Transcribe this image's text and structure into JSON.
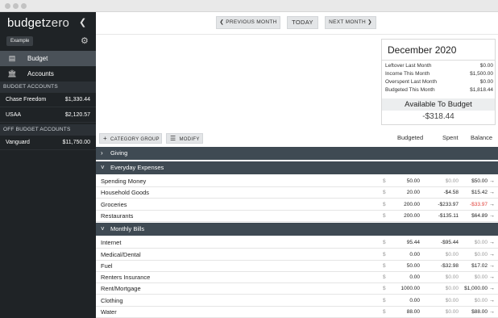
{
  "app": {
    "logo_main": "budget",
    "logo_accent": "zero",
    "collapse_icon": "chevron-left-icon"
  },
  "sidebar": {
    "budget_name": "Example",
    "nav": [
      {
        "label": "Budget",
        "icon": "wallet-icon",
        "active": true
      },
      {
        "label": "Accounts",
        "icon": "bank-icon",
        "active": false
      }
    ],
    "budget_accounts_label": "BUDGET ACCOUNTS",
    "budget_accounts": [
      {
        "name": "Chase Freedom",
        "balance": "$1,330.44"
      },
      {
        "name": "USAA",
        "balance": "$2,120.57"
      }
    ],
    "off_budget_label": "OFF BUDGET ACCOUNTS",
    "off_budget_accounts": [
      {
        "name": "Vanguard",
        "balance": "$11,750.00"
      }
    ]
  },
  "topnav": {
    "prev": "PREVIOUS MONTH",
    "today": "TODAY",
    "next": "NEXT MONTH"
  },
  "summary": {
    "month": "December 2020",
    "rows": [
      {
        "label": "Leftover Last Month",
        "value": "$0.00"
      },
      {
        "label": "Income This Month",
        "value": "$1,500.00"
      },
      {
        "label": "Overspent Last Month",
        "value": "$0.00"
      },
      {
        "label": "Budgeted This Month",
        "value": "$1,818.44"
      }
    ],
    "available_label": "Available To Budget",
    "available_value": "-$318.44"
  },
  "toolbar": {
    "category_group": "CATEGORY GROUP",
    "modify": "MODIFY"
  },
  "columns": {
    "budgeted": "Budgeted",
    "spent": "Spent",
    "balance": "Balance"
  },
  "currency_symbol": "$",
  "groups": [
    {
      "name": "Giving",
      "expanded": false,
      "categories": []
    },
    {
      "name": "Everyday Expenses",
      "expanded": true,
      "categories": [
        {
          "name": "Spending Money",
          "budgeted": "",
          "spent": "$0.00",
          "balance": "$50.00",
          "spent_tone": "grey",
          "balance_tone": "dark",
          "bud_display": "50.00"
        },
        {
          "name": "Household Goods",
          "budgeted": "20.00",
          "spent": "-$4.58",
          "balance": "$15.42",
          "spent_tone": "dark",
          "balance_tone": "dark"
        },
        {
          "name": "Groceries",
          "budgeted": "200.00",
          "spent": "-$233.97",
          "balance": "-$33.97",
          "spent_tone": "dark",
          "balance_tone": "red"
        },
        {
          "name": "Restaurants",
          "budgeted": "200.00",
          "spent": "-$135.11",
          "balance": "$64.89",
          "spent_tone": "dark",
          "balance_tone": "dark"
        }
      ]
    },
    {
      "name": "Monthly Bills",
      "expanded": true,
      "categories": [
        {
          "name": "Internet",
          "budgeted": "95.44",
          "spent": "-$95.44",
          "balance": "$0.00",
          "spent_tone": "dark",
          "balance_tone": "grey"
        },
        {
          "name": "Medical/Dental",
          "budgeted": "0.00",
          "spent": "$0.00",
          "balance": "$0.00",
          "spent_tone": "grey",
          "balance_tone": "grey"
        },
        {
          "name": "Fuel",
          "budgeted": "50.00",
          "spent": "-$32.98",
          "balance": "$17.02",
          "spent_tone": "dark",
          "balance_tone": "dark"
        },
        {
          "name": "Renters Insurance",
          "budgeted": "0.00",
          "spent": "$0.00",
          "balance": "$0.00",
          "spent_tone": "grey",
          "balance_tone": "grey"
        },
        {
          "name": "Rent/Mortgage",
          "budgeted": "1000.00",
          "spent": "$0.00",
          "balance": "$1,000.00",
          "spent_tone": "grey",
          "balance_tone": "dark"
        },
        {
          "name": "Clothing",
          "budgeted": "0.00",
          "spent": "$0.00",
          "balance": "$0.00",
          "spent_tone": "grey",
          "balance_tone": "grey"
        },
        {
          "name": "Water",
          "budgeted": "88.00",
          "spent": "$0.00",
          "balance": "$88.00",
          "spent_tone": "grey",
          "balance_tone": "dark"
        }
      ]
    }
  ]
}
